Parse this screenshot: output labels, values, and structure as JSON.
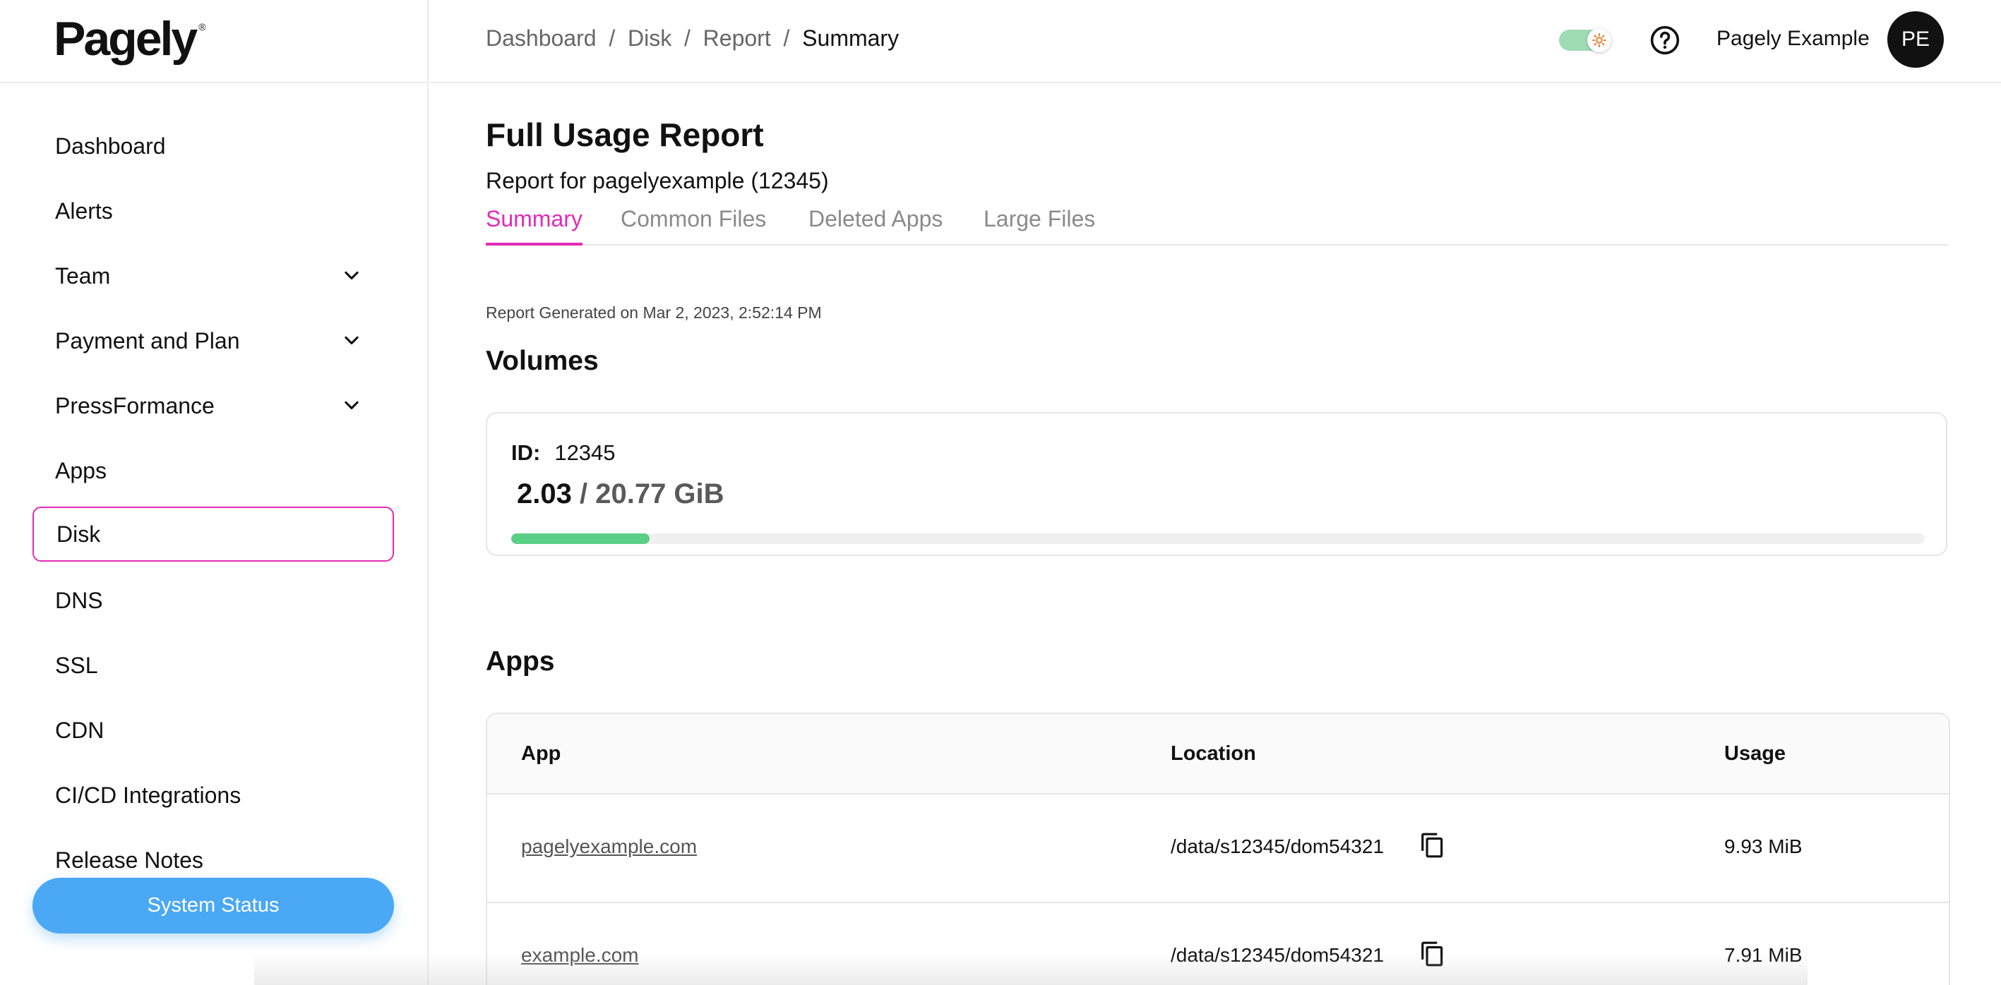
{
  "brand": {
    "logo": "Pagely",
    "reg_mark": "®"
  },
  "sidebar": {
    "items": [
      {
        "label": "Dashboard"
      },
      {
        "label": "Alerts"
      },
      {
        "label": "Team"
      },
      {
        "label": "Payment and Plan"
      },
      {
        "label": "PressFormance"
      },
      {
        "label": "Apps"
      },
      {
        "label": "Disk"
      },
      {
        "label": "DNS"
      },
      {
        "label": "SSL"
      },
      {
        "label": "CDN"
      },
      {
        "label": "CI/CD Integrations"
      },
      {
        "label": "Release Notes"
      }
    ],
    "active_item": "Disk",
    "status_button": "System Status"
  },
  "header": {
    "breadcrumb": [
      "Dashboard",
      "Disk",
      "Report",
      "Summary"
    ],
    "separator": "/",
    "user_name": "Pagely Example",
    "avatar_initials": "PE"
  },
  "main": {
    "title": "Full Usage Report",
    "subtitle": "Report for pagelyexample (12345)",
    "tabs": [
      {
        "label": "Summary"
      },
      {
        "label": "Common Files"
      },
      {
        "label": "Deleted Apps"
      },
      {
        "label": "Large Files"
      }
    ],
    "active_tab": "Summary",
    "generated": "Report Generated on Mar 2, 2023, 2:52:14 PM",
    "volumes_title": "Volumes",
    "volume": {
      "id_label": "ID:",
      "id_value": "12345",
      "used": "2.03",
      "total": "/ 20.77 GiB",
      "used_fraction": 0.0977
    },
    "apps_title": "Apps",
    "apps_table": {
      "columns": [
        "App",
        "Location",
        "Usage"
      ],
      "rows": [
        {
          "app": "pagelyexample.com",
          "location": "/data/s12345/dom54321",
          "usage": "9.93 MiB"
        },
        {
          "app": "example.com",
          "location": "/data/s12345/dom54321",
          "usage": "7.91 MiB"
        }
      ]
    }
  },
  "colors": {
    "accent": "#e22bb4",
    "progress": "#5ccf86",
    "status_button": "#4aa8f4",
    "toggle": "#9fdcb4"
  },
  "icons": {
    "chevron": "chevron-down-icon",
    "help": "help-circle-icon",
    "copy": "copy-icon",
    "theme": "sun-icon"
  }
}
